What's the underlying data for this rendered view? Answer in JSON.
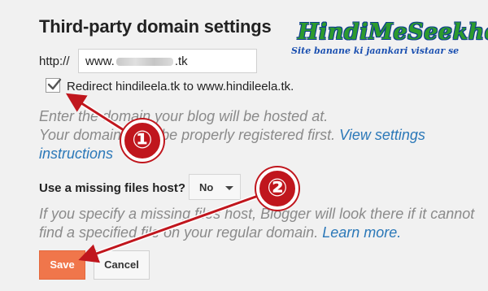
{
  "section": {
    "title": "Third-party domain settings"
  },
  "watermark": {
    "title": "HindiMeSeekhe",
    "subtitle": "Site banane ki jaankari vistaar se"
  },
  "domain": {
    "prefix": "http://",
    "value_start": "www.",
    "value_end": ".tk"
  },
  "redirect": {
    "checked": true,
    "label": "Redirect hindileela.tk to www.hindileela.tk."
  },
  "help_domain": {
    "line1": "Enter the domain your blog will be hosted at.",
    "line2": "Your domain must be properly registered first. ",
    "link": "View settings instructions"
  },
  "missing_files": {
    "label": "Use a missing files host?",
    "selected": "No"
  },
  "help_missing": {
    "text": "If you specify a missing files host, Blogger will look there if it cannot find a specified file on your regular domain. ",
    "link": "Learn more."
  },
  "buttons": {
    "save": "Save",
    "cancel": "Cancel"
  },
  "annotations": {
    "step1": "①",
    "step2": "②",
    "color": "#c0161d"
  }
}
